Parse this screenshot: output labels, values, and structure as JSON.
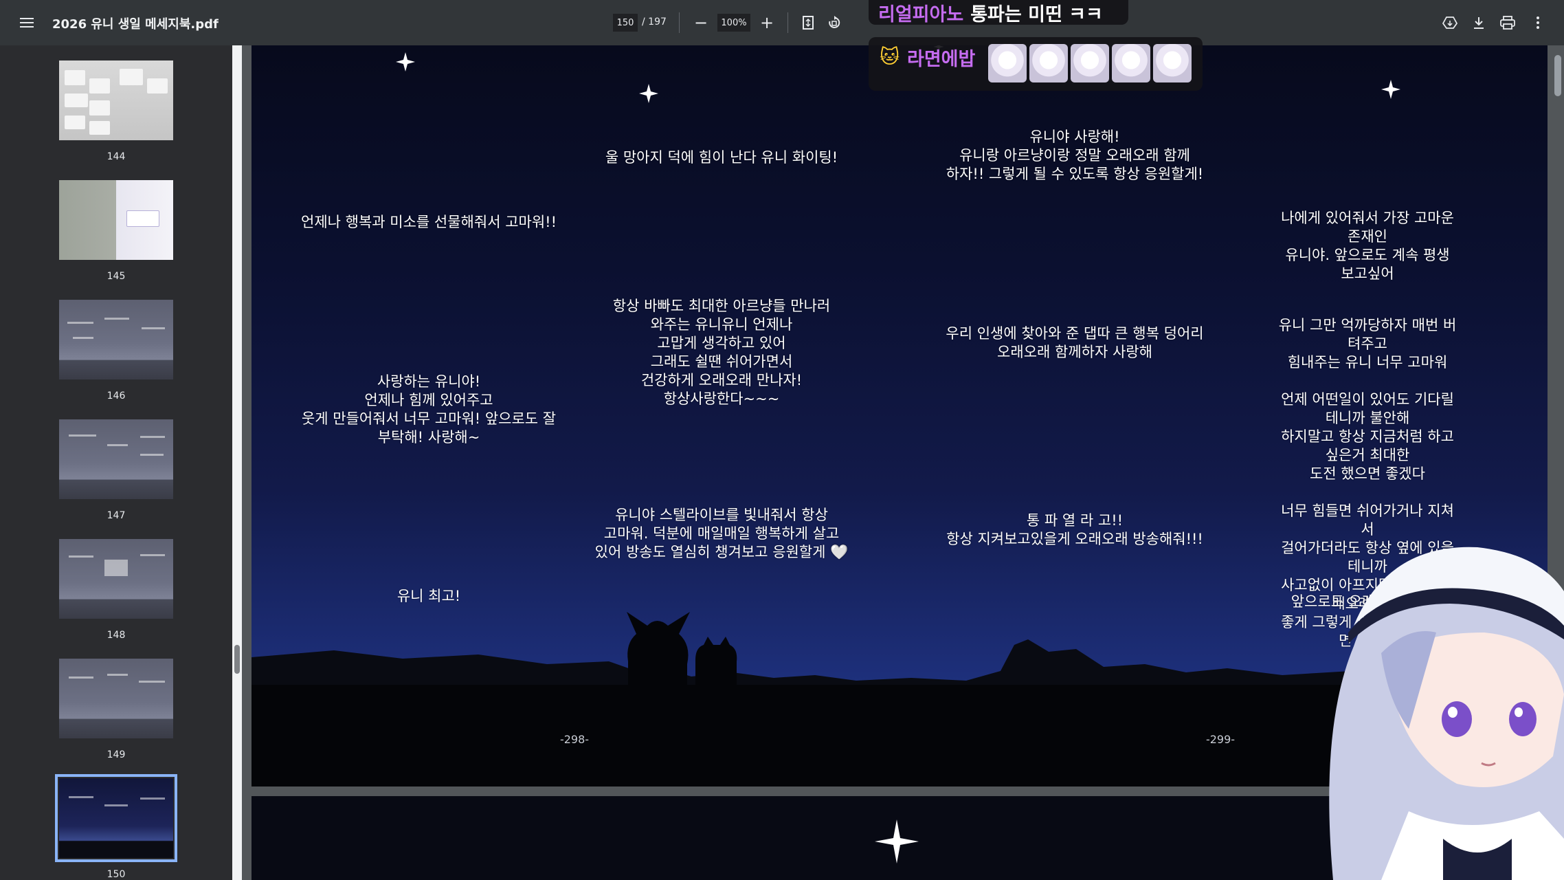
{
  "toolbar": {
    "title": "2026 유니 생일 메세지북.pdf",
    "current_page": "150",
    "page_total": "/ 197",
    "zoom": "100%",
    "zoom_out": "−",
    "zoom_in": "+"
  },
  "sidebar": {
    "thumbnails": [
      {
        "label": "144"
      },
      {
        "label": "145"
      },
      {
        "label": "146"
      },
      {
        "label": "147"
      },
      {
        "label": "148"
      },
      {
        "label": "149"
      },
      {
        "label": "150",
        "selected": true
      }
    ]
  },
  "pages": {
    "left_number": "-298-",
    "right_number": "-299-",
    "messages": [
      {
        "text": "언제나 행복과 미소를 선물해줘서 고마워!!"
      },
      {
        "text": "울 망아지 덕에 힘이 난다 유니 화이팅!"
      },
      {
        "text": "유니야 사랑해!\n유니랑 아르냥이랑 정말 오래오래 함께\n하자!! 그렇게 될 수 있도록 항상 응원할게!"
      },
      {
        "text": "나에게 있어줘서 가장 고마운 존재인\n유니야. 앞으로도 계속 평생 보고싶어"
      },
      {
        "text": "항상 바빠도 최대한 아르냥들 만나러\n와주는 유니유니 언제나\n고맙게 생각하고 있어\n그래도 쉴땐 쉬어가면서\n건강하게 오래오래 만나자!\n항상사랑한다~~~"
      },
      {
        "text": "우리 인생에 찾아와 준 댑따 큰 행복 덩어리\n오래오래 함께하자 사랑해"
      },
      {
        "text": "유니 그만 억까당하자 매번 버텨주고\n힘내주는 유니 너무 고마워\n\n언제 어떤일이 있어도 기다릴테니까 불안해\n하지말고 항상 지금처럼 하고싶은거 최대한\n도전 했으면 좋겠다\n\n너무 힘들면 쉬어가거나 지쳐서\n걸어가더라도 항상 옆에 있을테니까\n사고없이 아프지말고 같이 오래오래 사이\n좋게 그렇게 일상을 함께했으면 좋겠다"
      },
      {
        "text": "사랑하는 유니야!\n언제나 힘께 있어주고\n웃게 만들어줘서 너무 고마워! 앞으로도 잘\n부탁해! 사랑해~"
      },
      {
        "text": "유니야 스텔라이브를 빛내줘서 항상\n고마워. 덕분에 매일매일 행복하게 살고\n있어 방송도 열심히 챙겨보고 응원할게 🤍"
      },
      {
        "text": "통 파 열 라 고!!\n항상 지켜보고있을게 오래오래 방송해줘!!!"
      },
      {
        "text": "유니 최고!"
      },
      {
        "text": "앞으로도 오래"
      }
    ]
  },
  "chat": [
    {
      "user": "리얼피아노",
      "text": "통파는 미띤 ㅋㅋ"
    },
    {
      "user": "라면에밥",
      "badge": "cat-badge-icon",
      "emotes": [
        "emote",
        "emote",
        "emote",
        "emote",
        "emote"
      ]
    }
  ],
  "colors": {
    "toolbar_bg": "#323639",
    "sidebar_bg": "#2b2c2f",
    "selected_outline": "#8ab4f8",
    "chat_username": "#c56cf0",
    "sky_top": "#070a1c",
    "sky_bottom": "#27409a"
  }
}
